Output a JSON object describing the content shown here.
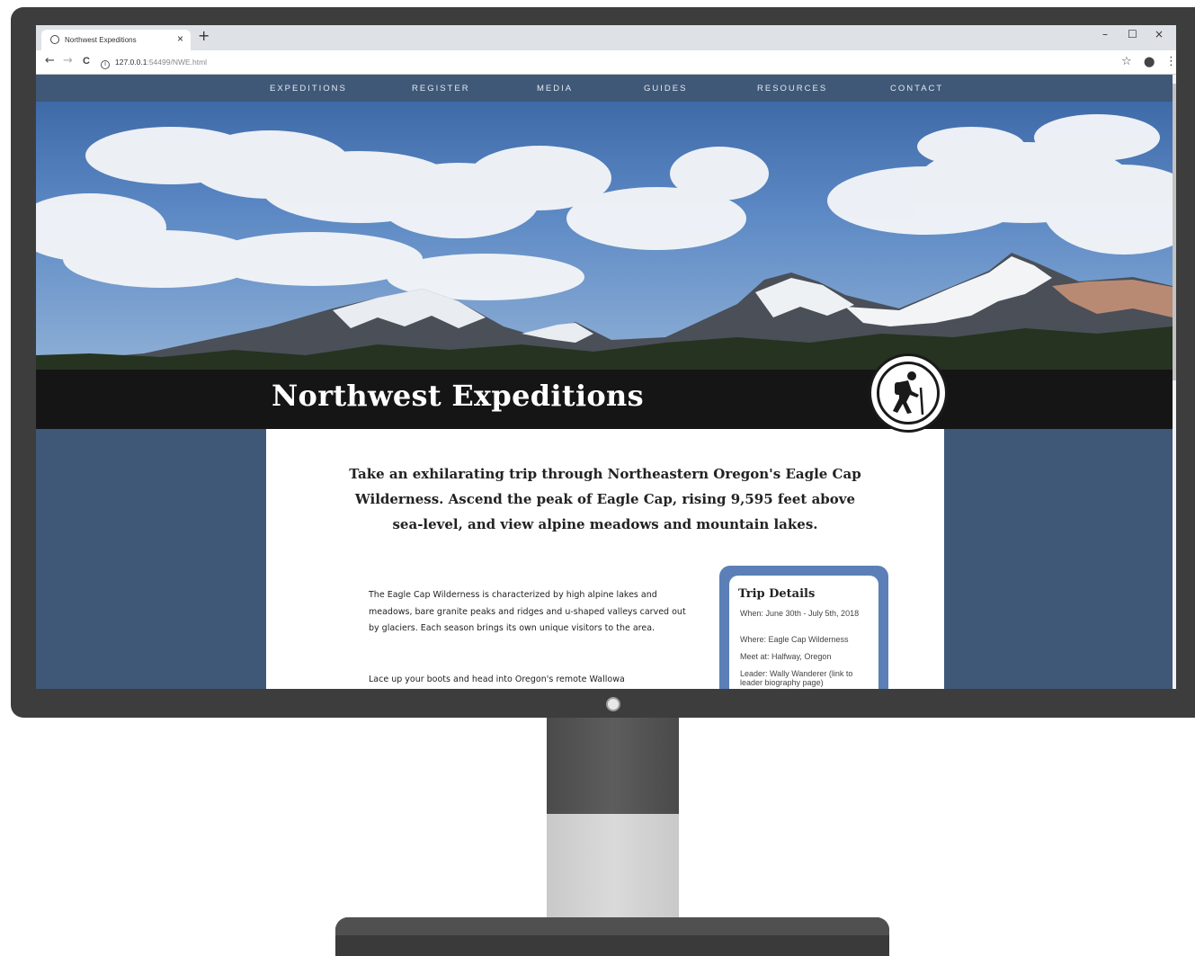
{
  "browser": {
    "tab_title": "Northwest Expeditions",
    "tab_close": "×",
    "new_tab": "+",
    "url_host": "127.0.0.1",
    "url_path": ":54499/NWE.html",
    "nav_back": "←",
    "nav_forward": "→",
    "nav_reload": "C",
    "bookmark_icon": "☆",
    "profile_icon": "⬤",
    "menu_icon": "⋮",
    "minimize": "–",
    "maximize": "☐",
    "close": "×"
  },
  "site": {
    "nav": [
      "EXPEDITIONS",
      "REGISTER",
      "MEDIA",
      "GUIDES",
      "RESOURCES",
      "CONTACT"
    ],
    "title": "Northwest Expeditions",
    "lede": "Take an exhilarating trip through Northeastern Oregon's Eagle Cap Wilderness. Ascend the peak of Eagle Cap, rising 9,595 feet above sea-level, and view alpine meadows and mountain lakes.",
    "paragraphs": [
      "The Eagle Cap Wilderness is characterized by high alpine lakes and meadows, bare granite peaks and ridges and u-shaped valleys carved out by glaciers. Each season brings its own unique visitors to the area.",
      "Lace up your boots and head into Oregon's remote Wallowa"
    ],
    "trip_details": {
      "heading": "Trip Details",
      "when": "When: June 30th - July 5th, 2018",
      "where": "Where: Eagle Cap Wilderness",
      "meet": "Meet at: Halfway, Oregon",
      "leader": "Leader: Wally Wanderer (link to leader biography page)"
    }
  },
  "colors": {
    "nav_bg": "#3f5878",
    "banner_bg": "#151515",
    "card_border": "#5b7fb6"
  }
}
